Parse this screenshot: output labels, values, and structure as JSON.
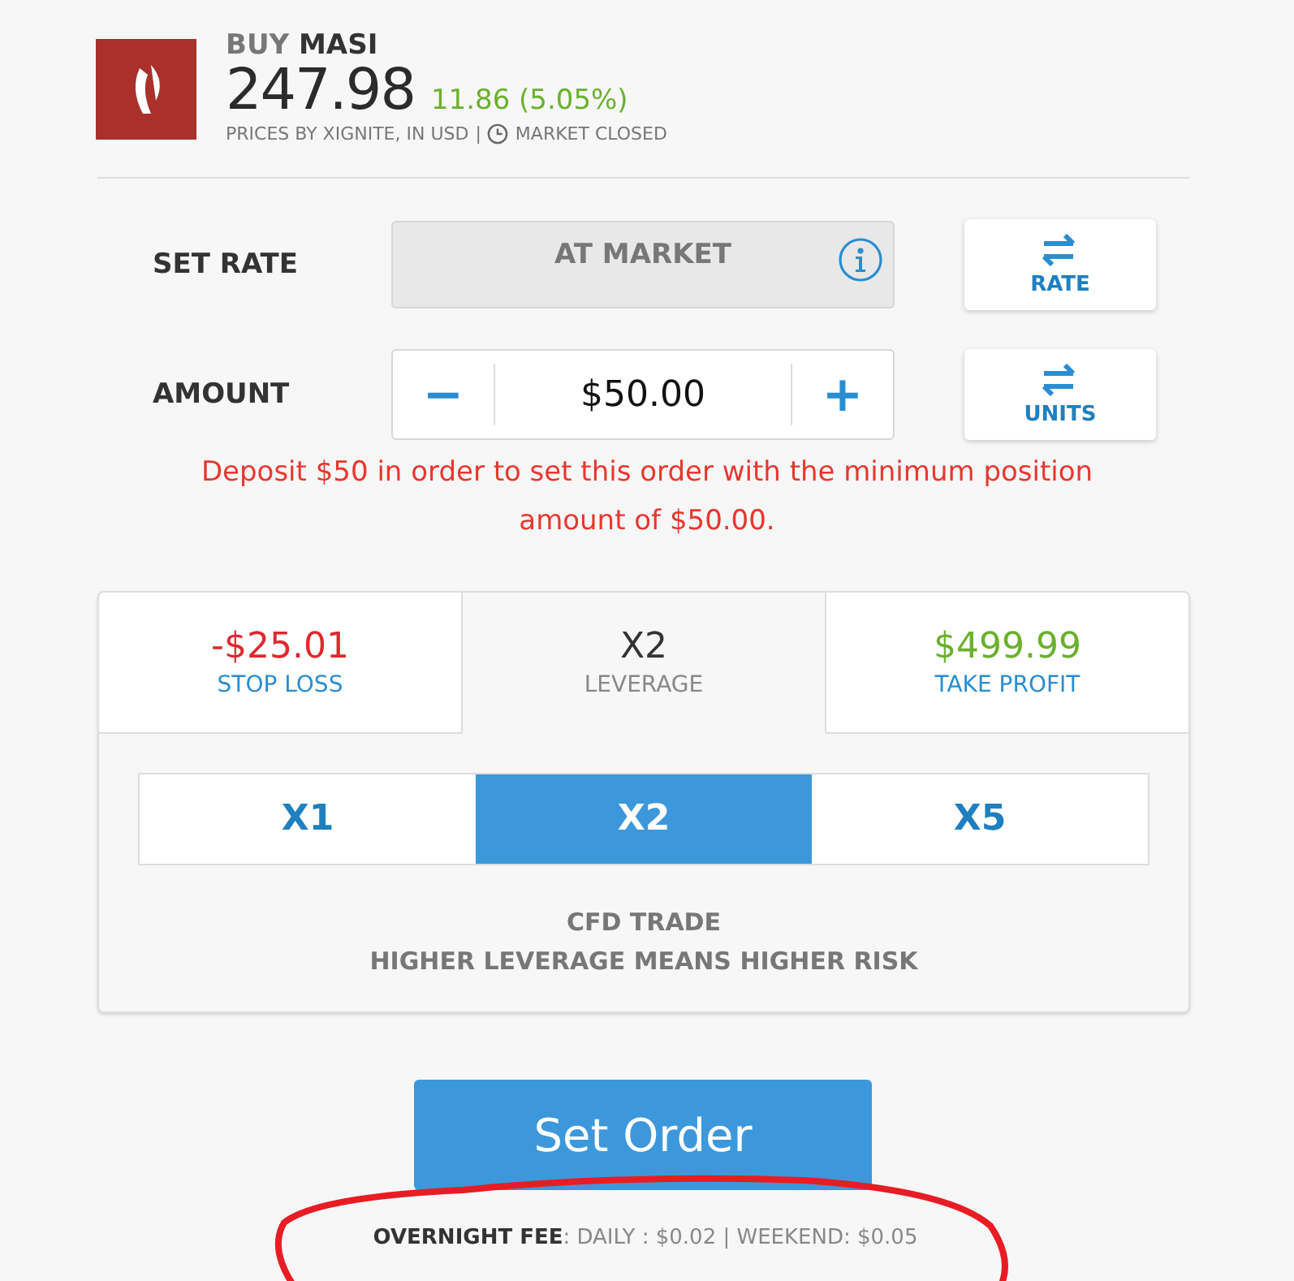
{
  "header": {
    "action": "BUY",
    "symbol": "MASI",
    "price": "247.98",
    "change": "11.86 (5.05%)",
    "source": "PRICES BY XIGNITE, IN USD",
    "separator": "|",
    "market_status": "MARKET CLOSED"
  },
  "rate": {
    "label": "SET RATE",
    "value": "AT MARKET",
    "toggle": "RATE"
  },
  "amount": {
    "label": "AMOUNT",
    "minus": "−",
    "value": "$50.00",
    "plus": "+",
    "toggle": "UNITS"
  },
  "warning": "Deposit $50 in order to set this order with the minimum position amount of $50.00.",
  "tabs": [
    {
      "value": "-$25.01",
      "label": "STOP LOSS",
      "kind": "loss",
      "selected": false
    },
    {
      "value": "X2",
      "label": "LEVERAGE",
      "kind": "leverage",
      "selected": true
    },
    {
      "value": "$499.99",
      "label": "TAKE PROFIT",
      "kind": "profit",
      "selected": false
    }
  ],
  "leverage_options": [
    {
      "label": "X1",
      "selected": false
    },
    {
      "label": "X2",
      "selected": true
    },
    {
      "label": "X5",
      "selected": false
    }
  ],
  "notice": [
    "CFD TRADE",
    "HIGHER LEVERAGE MEANS HIGHER RISK"
  ],
  "submit": "Set Order",
  "overnight_fee": {
    "text": "**OVERNIGHT FEE**: DAILY : $0.02 | WEEKEND: $0.05",
    "circled": true
  }
}
